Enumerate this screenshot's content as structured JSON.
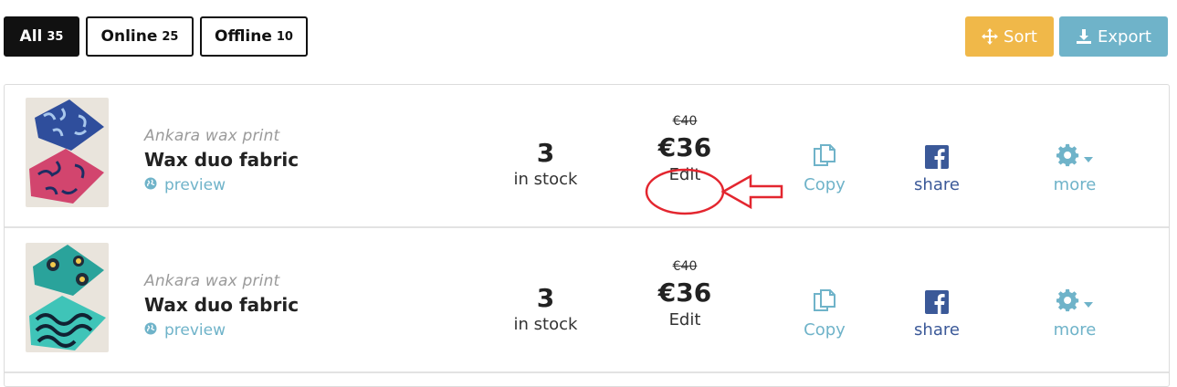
{
  "filters": [
    {
      "label": "All",
      "count": "35"
    },
    {
      "label": "Online",
      "count": "25"
    },
    {
      "label": "Offline",
      "count": "10"
    }
  ],
  "actions": {
    "sort": "Sort",
    "export": "Export"
  },
  "colors": {
    "sort": "#f0b849",
    "export": "#6fb3c9",
    "link": "#6fb3c9",
    "facebook": "#3b5998",
    "annotation": "#e3262f"
  },
  "products": [
    {
      "category": "Ankara wax print",
      "name": "Wax duo fabric",
      "preview": "preview",
      "stock": "3",
      "stock_label": "in stock",
      "old_price": "€40",
      "price": "€36",
      "edit": "Edit",
      "copy": "Copy",
      "share": "share",
      "more": "more"
    },
    {
      "category": "Ankara wax print",
      "name": "Wax duo fabric",
      "preview": "preview",
      "stock": "3",
      "stock_label": "in stock",
      "old_price": "€40",
      "price": "€36",
      "edit": "Edit",
      "copy": "Copy",
      "share": "share",
      "more": "more"
    }
  ]
}
